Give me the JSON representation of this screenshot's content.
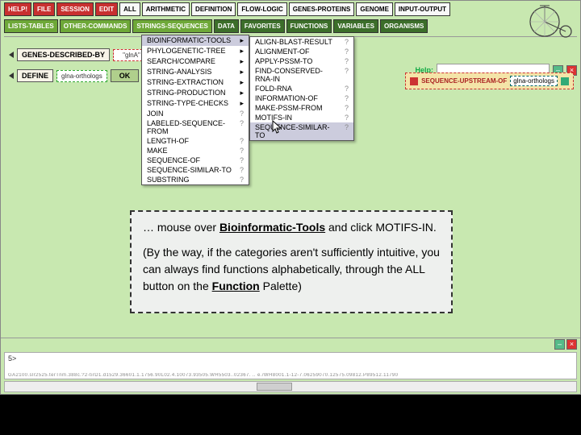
{
  "palette": {
    "row1": [
      "HELP!",
      "FILE",
      "SESSION",
      "EDIT",
      "ALL",
      "ARITHMETIC",
      "DEFINITION",
      "FLOW-LOGIC",
      "GENES-PROTEINS",
      "GENOME",
      "INPUT-OUTPUT"
    ],
    "row2": [
      "LISTS-TABLES",
      "OTHER-COMMANDS",
      "STRINGS-SEQUENCES",
      "DATA",
      "FAVORITES",
      "FUNCTIONS",
      "VARIABLES",
      "ORGANISMS"
    ]
  },
  "help": {
    "label": "Help:",
    "value": ""
  },
  "expr": {
    "genes_described_by": "GENES-DESCRIBED-BY",
    "glnA": "\"glnA\"",
    "define": "DEFINE",
    "orthologs_var": "glna-orthologs",
    "ok": "OK",
    "seq_upstream": "SEQUENCE-UPSTREAM-OF",
    "seq_val": "glna-orthologs"
  },
  "menu1": [
    "BIOINFORMATIC-TOOLS",
    "PHYLOGENETIC-TREE",
    "SEARCH/COMPARE",
    "STRING-ANALYSIS",
    "STRING-EXTRACTION",
    "STRING-PRODUCTION",
    "STRING-TYPE-CHECKS",
    "JOIN",
    "LABELED-SEQUENCE-FROM",
    "LENGTH-OF",
    "MAKE",
    "SEQUENCE-OF",
    "SEQUENCE-SIMILAR-TO",
    "SUBSTRING"
  ],
  "menu2": [
    "ALIGN-BLAST-RESULT",
    "ALIGNMENT-OF",
    "APPLY-PSSM-TO",
    "FIND-CONSERVED-RNA-IN",
    "FOLD-RNA",
    "INFORMATION-OF",
    "MAKE-PSSM-FROM",
    "MOTIFS-IN",
    "SEQUENCE-SIMILAR-TO"
  ],
  "callout": {
    "p1a": "… mouse over ",
    "p1b": "Bioinformatic-Tools",
    "p1c": " and click MOTIFS-IN.",
    "p2a": "(By the way, if the categories aren't sufficiently intuitive, you can always find functions alphabetically, through the ALL button on the ",
    "p2b": "Function",
    "p2c": " Palette)"
  },
  "console": {
    "prompt": "5>",
    "trace": "GA2100.slr2525.terTnm.388c.?2-tirD1.d1529.36601.1.1756.90L02.4.10073.93505.WH5503..02367. .. e./WH8001.1-12-7.06259070.12575.09812.P89512.11790"
  }
}
